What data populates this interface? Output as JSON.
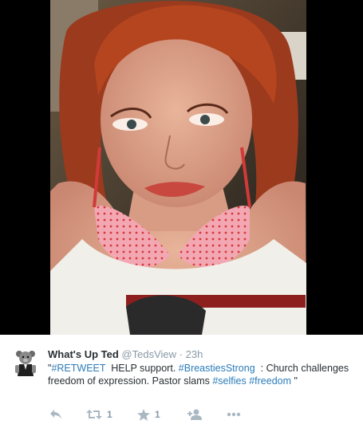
{
  "tweet": {
    "display_name": "What's Up Ted",
    "handle": "@TedsView",
    "separator": "·",
    "time": "23h",
    "text_parts": [
      {
        "text": "\"",
        "type": "plain"
      },
      {
        "text": "#RETWEET",
        "type": "link"
      },
      {
        "text": "  HELP support. ",
        "type": "plain"
      },
      {
        "text": "#BreastiesStrong",
        "type": "link"
      },
      {
        "text": "  : Church challenges freedom of expression. Pastor slams ",
        "type": "plain"
      },
      {
        "text": "#selfies",
        "type": "link"
      },
      {
        "text": " ",
        "type": "plain"
      },
      {
        "text": "#freedom",
        "type": "link"
      },
      {
        "text": " \"",
        "type": "plain"
      }
    ],
    "actions": {
      "reply": {
        "icon": "reply-icon"
      },
      "retweet": {
        "icon": "retweet-icon",
        "count": "1"
      },
      "favorite": {
        "icon": "star-icon",
        "count": "1"
      },
      "follow": {
        "icon": "add-user-icon"
      },
      "more": {
        "icon": "more-icon"
      }
    }
  },
  "colors": {
    "link": "#2b7bb9",
    "name": "#292f33",
    "muted": "#8899a6",
    "action": "#aab8c2"
  }
}
